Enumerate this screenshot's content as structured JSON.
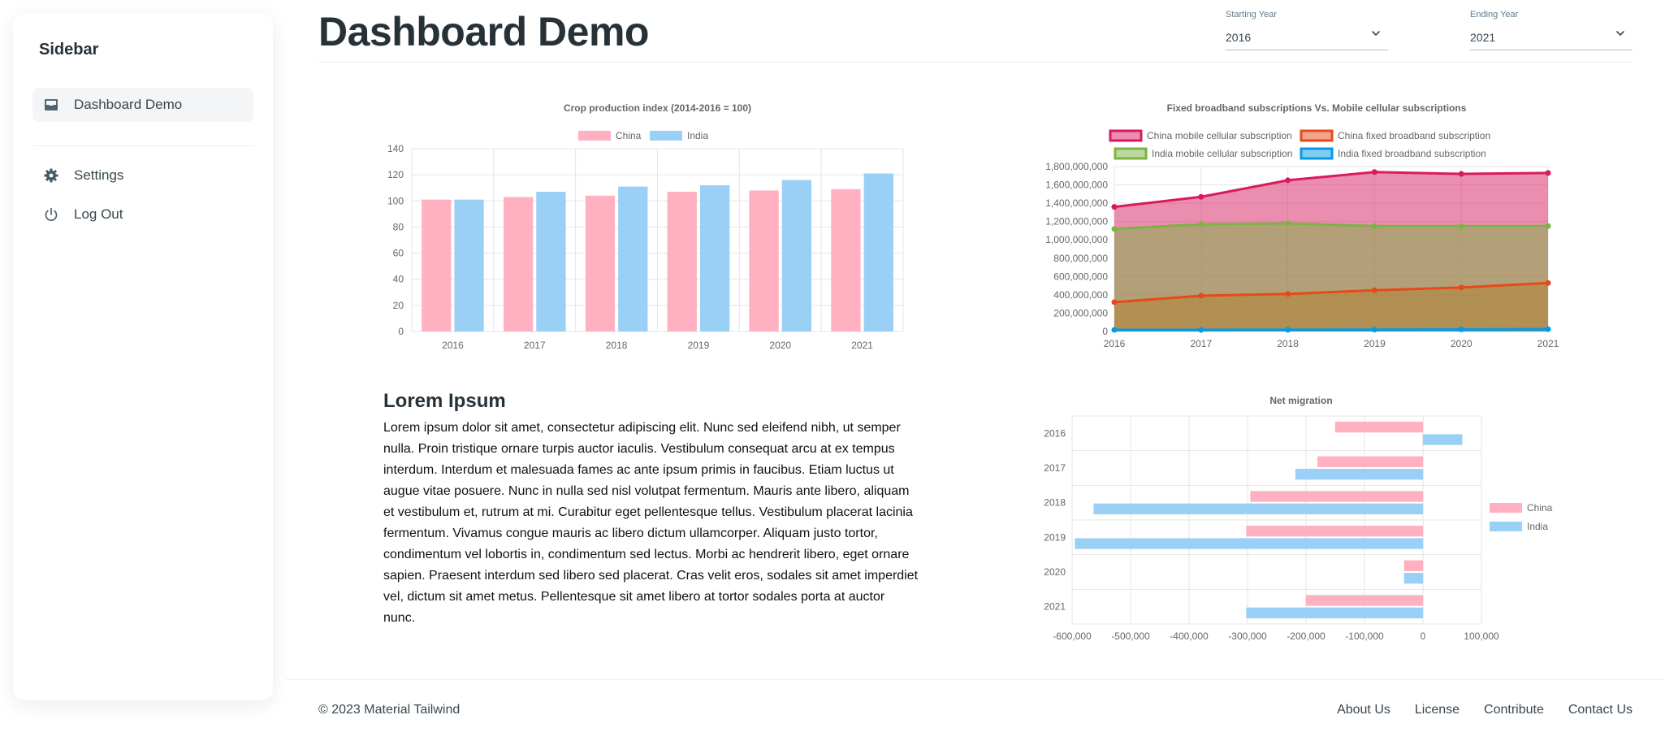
{
  "sidebar": {
    "title": "Sidebar",
    "items": [
      {
        "label": "Dashboard Demo",
        "icon": "inbox-icon"
      },
      {
        "label": "Settings",
        "icon": "gear-icon"
      },
      {
        "label": "Log Out",
        "icon": "power-icon"
      }
    ]
  },
  "header": {
    "title": "Dashboard Demo",
    "start": {
      "label": "Starting Year",
      "value": "2016"
    },
    "end": {
      "label": "Ending Year",
      "value": "2021"
    }
  },
  "lorem": {
    "title": "Lorem Ipsum",
    "body": "Lorem ipsum dolor sit amet, consectetur adipiscing elit. Nunc sed eleifend nibh, ut semper nulla. Proin tristique ornare turpis auctor iaculis. Vestibulum consequat arcu at ex tempus interdum. Interdum et malesuada fames ac ante ipsum primis in faucibus. Etiam luctus ut augue vitae posuere. Nunc in nulla sed nisl volutpat fermentum. Mauris ante libero, aliquam et vestibulum et, rutrum at mi. Curabitur eget pellentesque tellus. Vestibulum placerat lacinia fermentum. Vivamus congue mauris ac libero dictum ullamcorper. Aliquam justo tortor, condimentum vel lobortis in, condimentum sed lectus. Morbi ac hendrerit libero, eget ornare sapien. Praesent interdum sed libero sed placerat. Cras velit eros, sodales sit amet imperdiet vel, dictum sit amet metus. Pellentesque sit amet libero at tortor sodales porta at auctor nunc."
  },
  "footer": {
    "copyright": "© 2023 Material Tailwind",
    "links": [
      "About Us",
      "License",
      "Contribute",
      "Contact Us"
    ]
  },
  "chart_data": [
    {
      "type": "bar",
      "title": "Crop production index (2014-2016 = 100)",
      "categories": [
        "2016",
        "2017",
        "2018",
        "2019",
        "2020",
        "2021"
      ],
      "series": [
        {
          "name": "China",
          "values": [
            101,
            103,
            104,
            107,
            108,
            109
          ],
          "color": "#ffb1c1"
        },
        {
          "name": "India",
          "values": [
            101,
            107,
            111,
            112,
            116,
            121
          ],
          "color": "#9ad0f5"
        }
      ],
      "ylim": [
        0,
        140
      ],
      "yticks": [
        0,
        20,
        40,
        60,
        80,
        100,
        120,
        140
      ],
      "legend": "top",
      "grid": true
    },
    {
      "type": "area",
      "title": "Fixed broadband subscriptions Vs. Mobile cellular subscriptions",
      "categories": [
        "2016",
        "2017",
        "2018",
        "2019",
        "2020",
        "2021"
      ],
      "series": [
        {
          "name": "China mobile cellular subscription",
          "values": [
            1360000000,
            1470000000,
            1650000000,
            1740000000,
            1720000000,
            1730000000
          ],
          "color": "#d81b60"
        },
        {
          "name": "China fixed broadband subscription",
          "values": [
            320000000,
            390000000,
            410000000,
            450000000,
            480000000,
            530000000
          ],
          "color": "#e64a19"
        },
        {
          "name": "India mobile cellular subscription",
          "values": [
            1120000000,
            1170000000,
            1180000000,
            1150000000,
            1150000000,
            1150000000
          ],
          "color": "#7cb342"
        },
        {
          "name": "India fixed broadband subscription",
          "values": [
            18000000,
            18000000,
            19000000,
            20000000,
            23000000,
            25000000
          ],
          "color": "#039be5"
        }
      ],
      "ylim": [
        0,
        1800000000
      ],
      "yticks": [
        "0",
        "200,000,000",
        "400,000,000",
        "600,000,000",
        "800,000,000",
        "1,000,000,000",
        "1,200,000,000",
        "1,400,000,000",
        "1,600,000,000",
        "1,800,000,000"
      ],
      "legend": "top",
      "grid": true
    },
    {
      "type": "bar",
      "orientation": "horizontal",
      "title": "Net migration",
      "categories": [
        "2016",
        "2017",
        "2018",
        "2019",
        "2020",
        "2021"
      ],
      "series": [
        {
          "name": "China",
          "values": [
            -150000,
            -180000,
            -295000,
            -302000,
            -32000,
            -200000
          ],
          "color": "#ffb1c1"
        },
        {
          "name": "India",
          "values": [
            67000,
            -218000,
            -563000,
            -595000,
            -32000,
            -302000
          ],
          "color": "#9ad0f5"
        }
      ],
      "xlim": [
        -600000,
        100000
      ],
      "xticks": [
        "-600,000",
        "-500,000",
        "-400,000",
        "-300,000",
        "-200,000",
        "-100,000",
        "0",
        "100,000"
      ],
      "legend": "right",
      "grid": true
    }
  ]
}
